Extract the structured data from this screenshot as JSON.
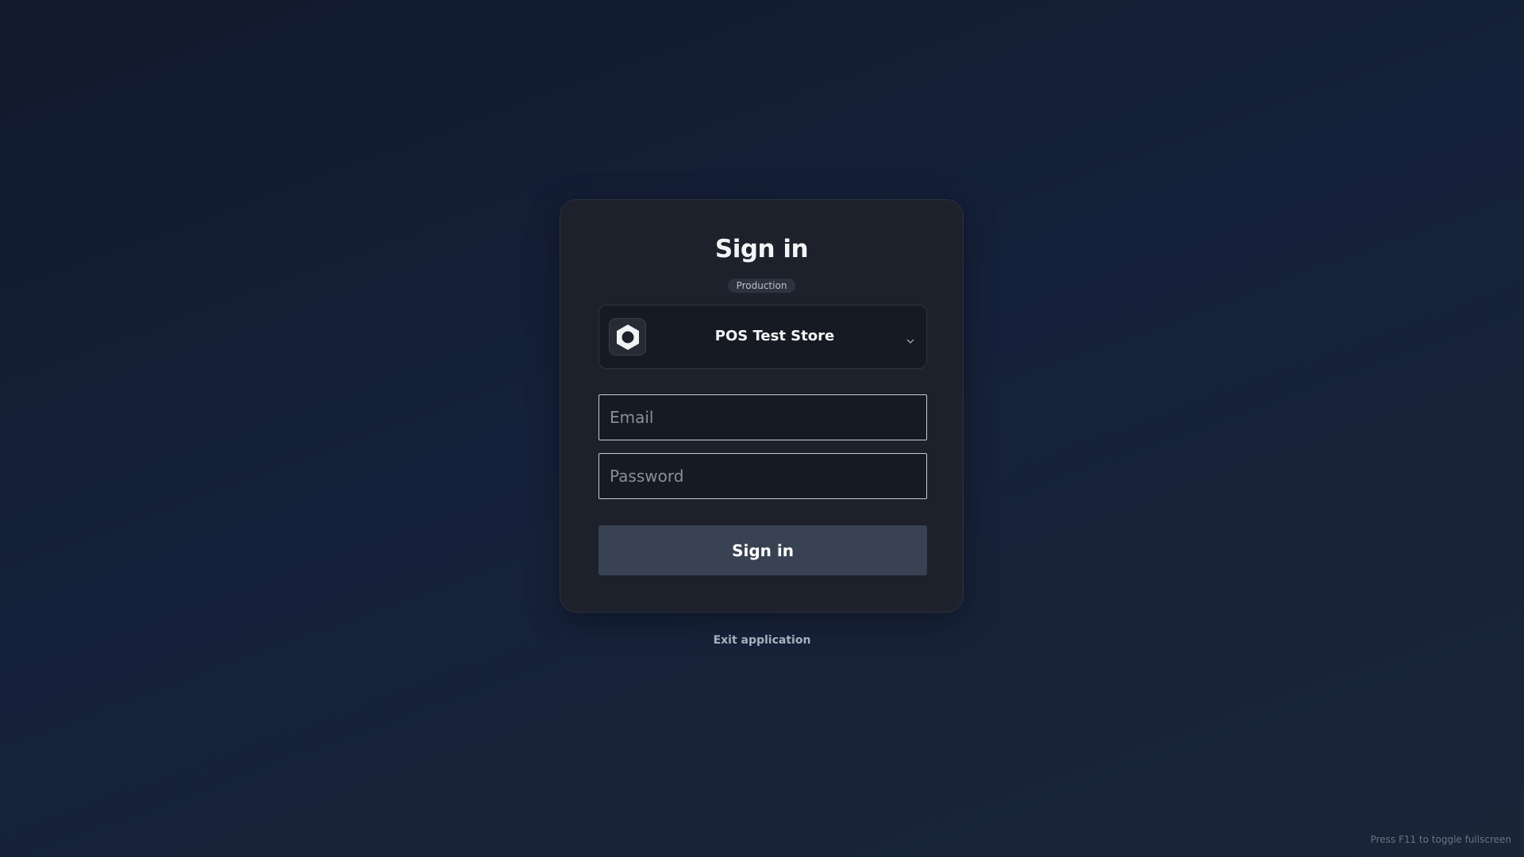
{
  "login": {
    "title": "Sign in",
    "environment_badge": "Production",
    "store_selector": {
      "selected_store": "POS Test Store",
      "logo_icon": "hexagon-logo-icon",
      "dropdown_icon": "chevron-down-icon"
    },
    "email": {
      "placeholder": "Email",
      "value": ""
    },
    "password": {
      "placeholder": "Password",
      "value": ""
    },
    "submit_label": "Sign in"
  },
  "footer": {
    "exit_label": "Exit application",
    "fullscreen_hint": "Press F11 to toggle fullscreen"
  },
  "colors": {
    "background": "#131c30",
    "card": "#1d212b",
    "button": "#384252",
    "badge": "#2d333e"
  }
}
